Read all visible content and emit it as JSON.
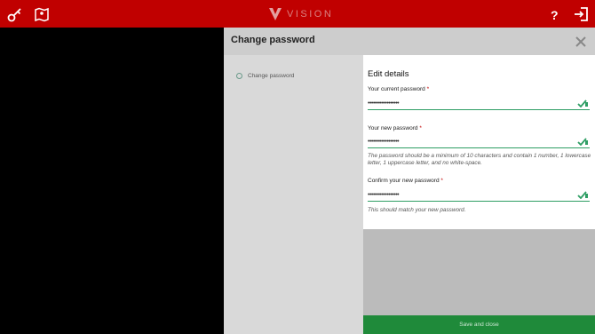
{
  "app": {
    "brand": "VISION"
  },
  "topbar": {
    "icons": [
      "key-icon",
      "map-icon",
      "help-icon",
      "logout-icon"
    ]
  },
  "modal": {
    "title": "Change password",
    "sidebar": {
      "items": [
        {
          "label": "Change password"
        }
      ]
    },
    "card_title": "Edit details",
    "fields": [
      {
        "label": "Your current password",
        "required": "*",
        "value": "••••••••••••••••••",
        "hint": ""
      },
      {
        "label": "Your new password",
        "required": "*",
        "value": "••••••••••••••••••",
        "hint": "The password should be a minimum of 10 characters and contain 1 number, 1 lowercase letter, 1 uppercase letter, and no white-space."
      },
      {
        "label": "Confirm your new password",
        "required": "*",
        "value": "••••••••••••••••••",
        "hint": "This should match your new password."
      }
    ],
    "save_label": "Save and close"
  },
  "colors": {
    "brand_red": "#c00000",
    "accent_green": "#2e9e64",
    "footer_green": "#1f8a3a"
  }
}
